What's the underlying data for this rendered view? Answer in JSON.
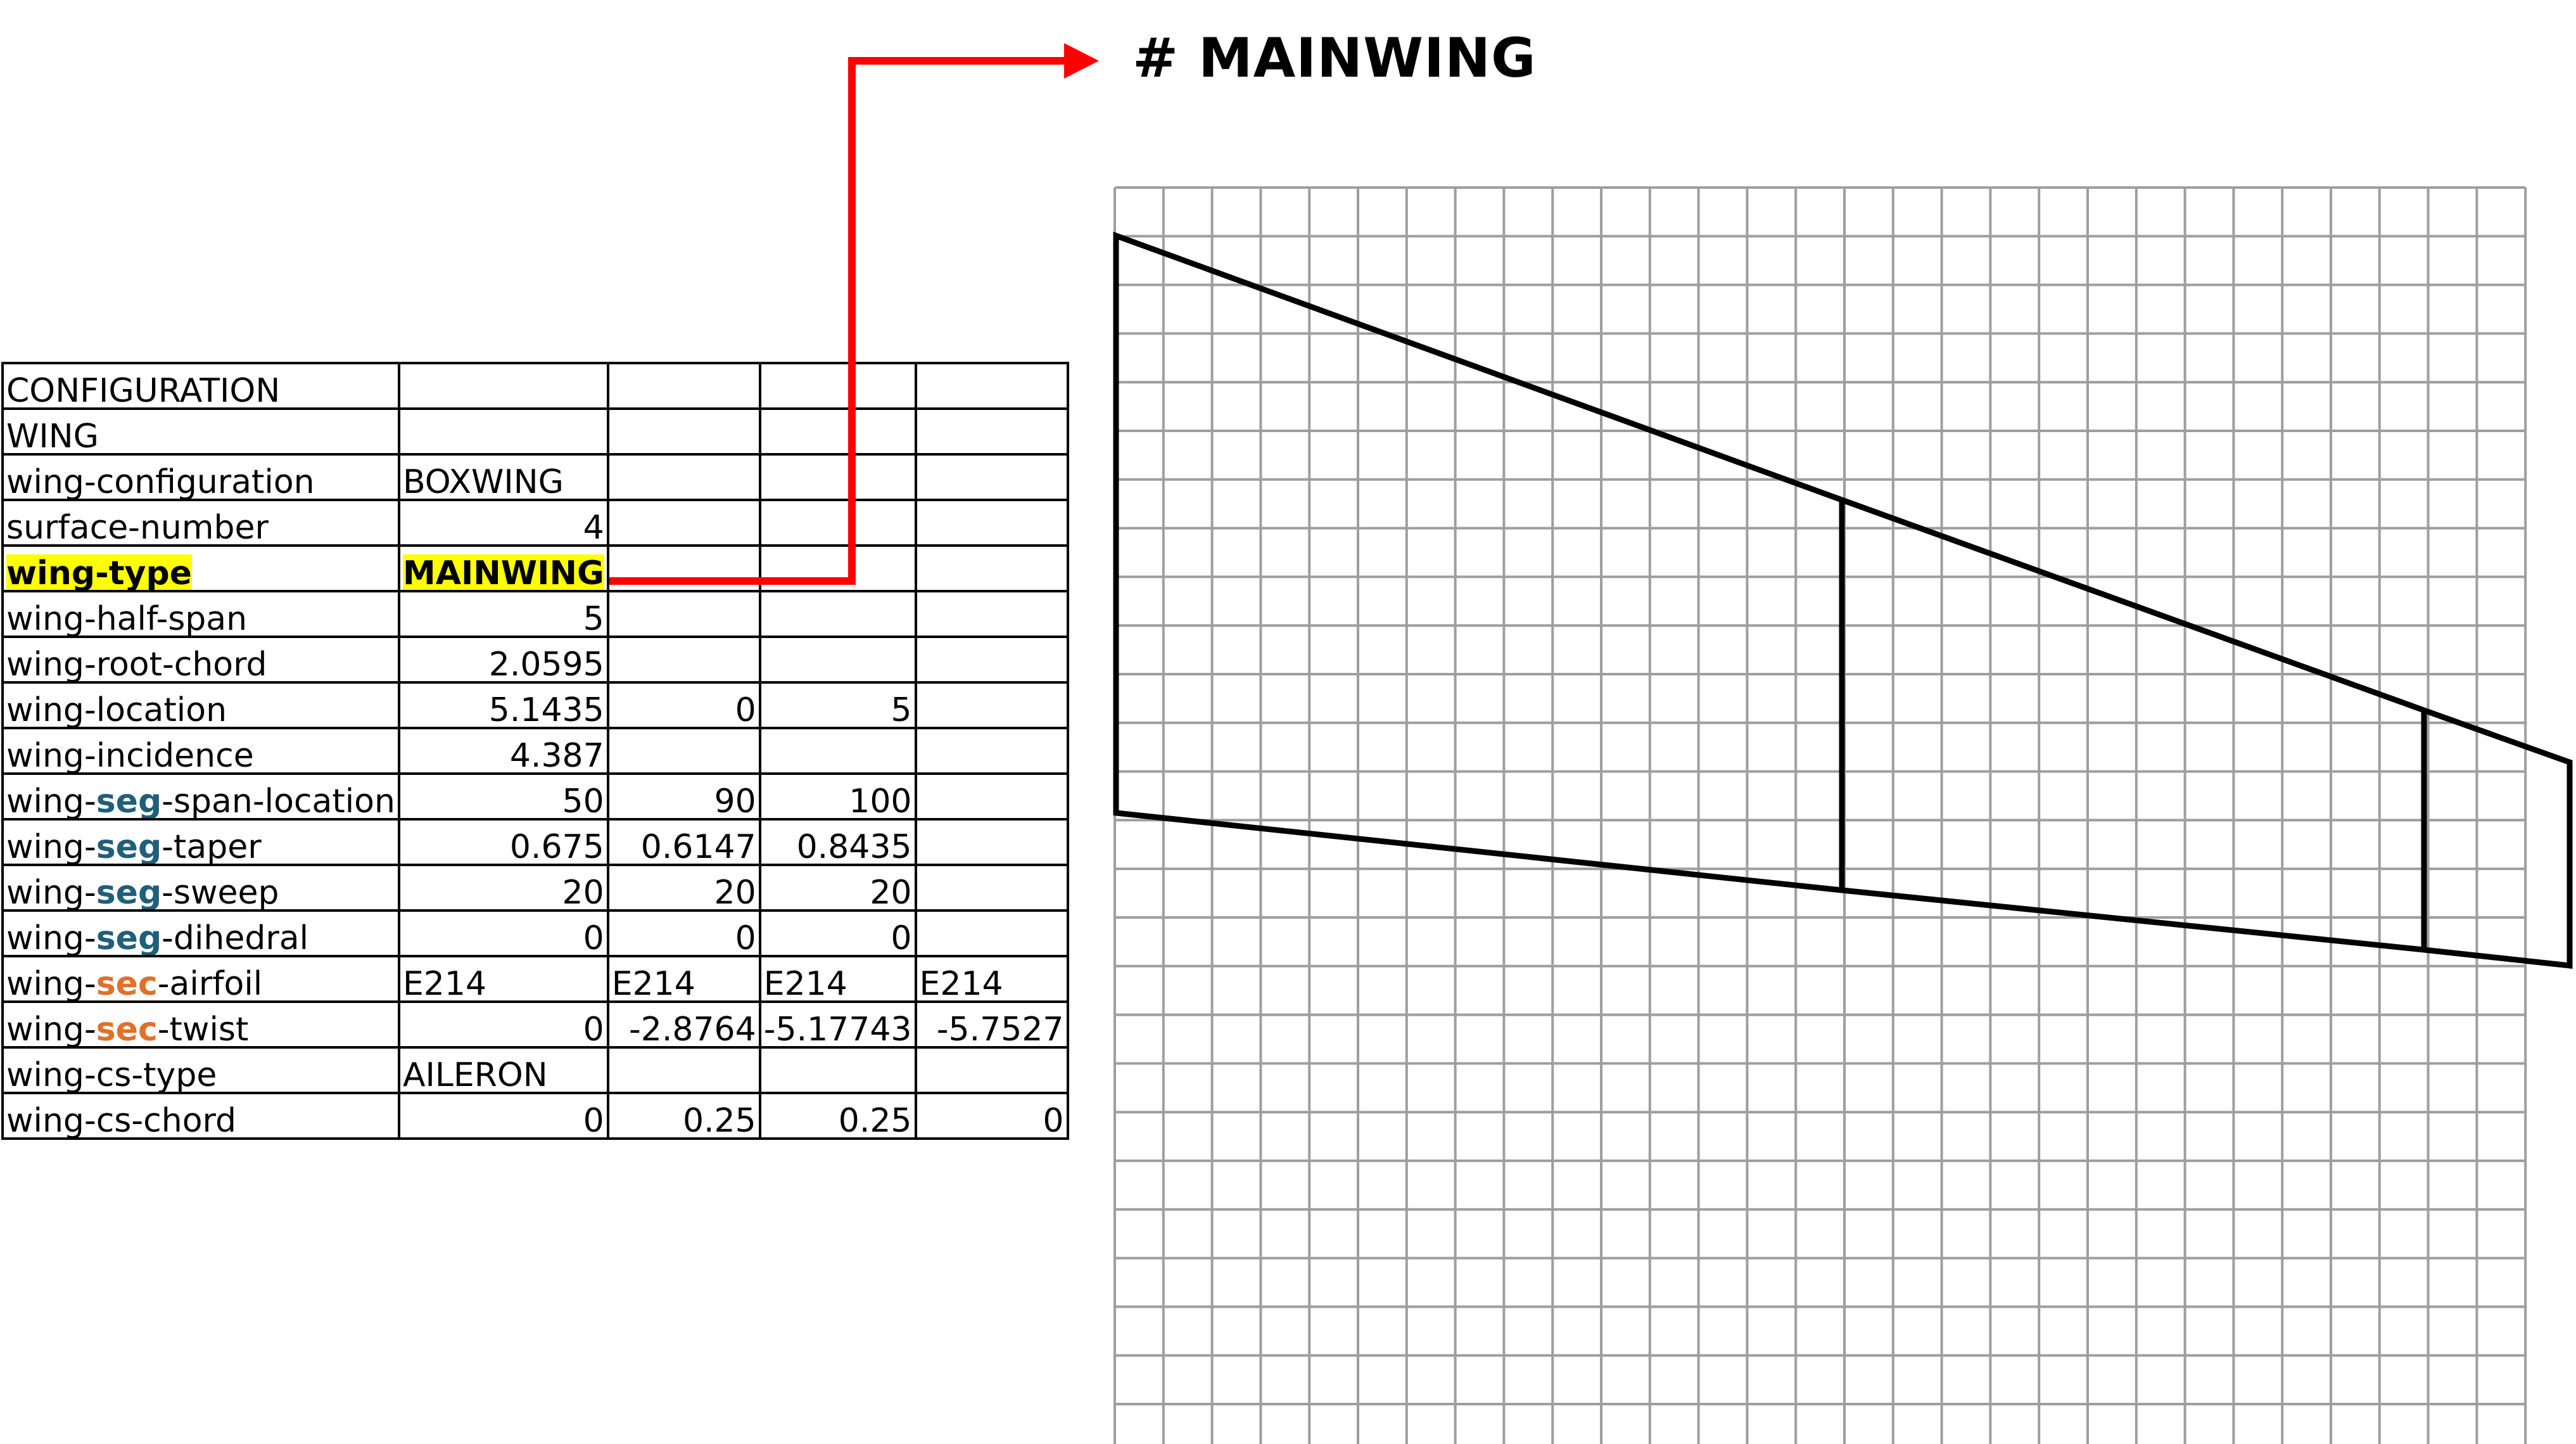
{
  "title": "# MAINWING",
  "table": {
    "rows": [
      {
        "label": [
          "CONFIGURATION"
        ],
        "cells": [
          "",
          "",
          "",
          ""
        ]
      },
      {
        "label": [
          "WING"
        ],
        "cells": [
          "",
          "",
          "",
          ""
        ]
      },
      {
        "label": [
          "wing-configuration"
        ],
        "cells": [
          "BOXWING",
          "",
          "",
          ""
        ]
      },
      {
        "label": [
          "surface-number"
        ],
        "cells": [
          "4",
          "",
          "",
          ""
        ]
      },
      {
        "label": [
          "wing-type"
        ],
        "cells": [
          "MAINWING",
          "",
          "",
          ""
        ],
        "highlight": true
      },
      {
        "label": [
          "wing-half-span"
        ],
        "cells": [
          "5",
          "",
          "",
          ""
        ]
      },
      {
        "label": [
          "wing-root-chord"
        ],
        "cells": [
          "2.0595",
          "",
          "",
          ""
        ]
      },
      {
        "label": [
          "wing-location"
        ],
        "cells": [
          "5.1435",
          "0",
          "5",
          ""
        ]
      },
      {
        "label": [
          "wing-incidence"
        ],
        "cells": [
          "4.387",
          "",
          "",
          ""
        ]
      },
      {
        "label": [
          "wing-",
          "seg",
          "-span-location"
        ],
        "cells": [
          "50",
          "90",
          "100",
          ""
        ]
      },
      {
        "label": [
          "wing-",
          "seg",
          "-taper"
        ],
        "cells": [
          "0.675",
          "0.6147",
          "0.8435",
          ""
        ]
      },
      {
        "label": [
          "wing-",
          "seg",
          "-sweep"
        ],
        "cells": [
          "20",
          "20",
          "20",
          ""
        ]
      },
      {
        "label": [
          "wing-",
          "seg",
          "-dihedral"
        ],
        "cells": [
          "0",
          "0",
          "0",
          ""
        ]
      },
      {
        "label": [
          "wing-",
          "sec",
          "-airfoil"
        ],
        "cells": [
          "E214",
          "E214",
          "E214",
          "E214"
        ]
      },
      {
        "label": [
          "wing-",
          "sec",
          "-twist"
        ],
        "cells": [
          "0",
          "-2.8764",
          "-5.17743",
          "-5.7527"
        ]
      },
      {
        "label": [
          "wing-cs-type"
        ],
        "cells": [
          "AILERON",
          "",
          "",
          ""
        ]
      },
      {
        "label": [
          "wing-cs-chord"
        ],
        "cells": [
          "0",
          "0.25",
          "0.25",
          "0"
        ]
      }
    ]
  },
  "colors": {
    "arrow": "#ff0000",
    "highlight": "#ffff00",
    "seg": "#1f5f7a",
    "sec": "#e0702a",
    "grid": "#9e9e9e",
    "wing_outline": "#000000"
  }
}
